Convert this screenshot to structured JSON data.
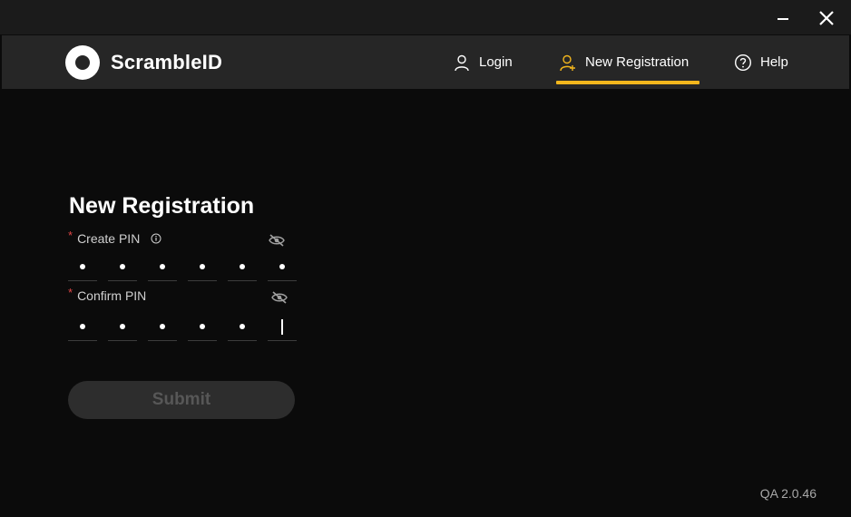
{
  "window": {
    "minimize_icon": "minimize-icon",
    "close_icon": "close-icon"
  },
  "header": {
    "brand": "ScrambleID",
    "nav": [
      {
        "label": "Login",
        "icon": "user-icon"
      },
      {
        "label": "New Registration",
        "icon": "user-add-icon",
        "active": true
      },
      {
        "label": "Help",
        "icon": "help-icon"
      }
    ],
    "accent_color": "#f2b61d"
  },
  "form": {
    "title": "New Registration",
    "create_pin": {
      "required_mark": "*",
      "label": "Create PIN",
      "info_icon": "info-icon",
      "visibility_icon": "eye-off-icon",
      "digits_filled": 6,
      "digits_total": 6
    },
    "confirm_pin": {
      "required_mark": "*",
      "label": "Confirm PIN",
      "visibility_icon": "eye-off-icon",
      "digits_filled": 5,
      "digits_total": 6
    },
    "submit_label": "Submit",
    "submit_enabled": false
  },
  "footer": {
    "version": "QA 2.0.46"
  }
}
